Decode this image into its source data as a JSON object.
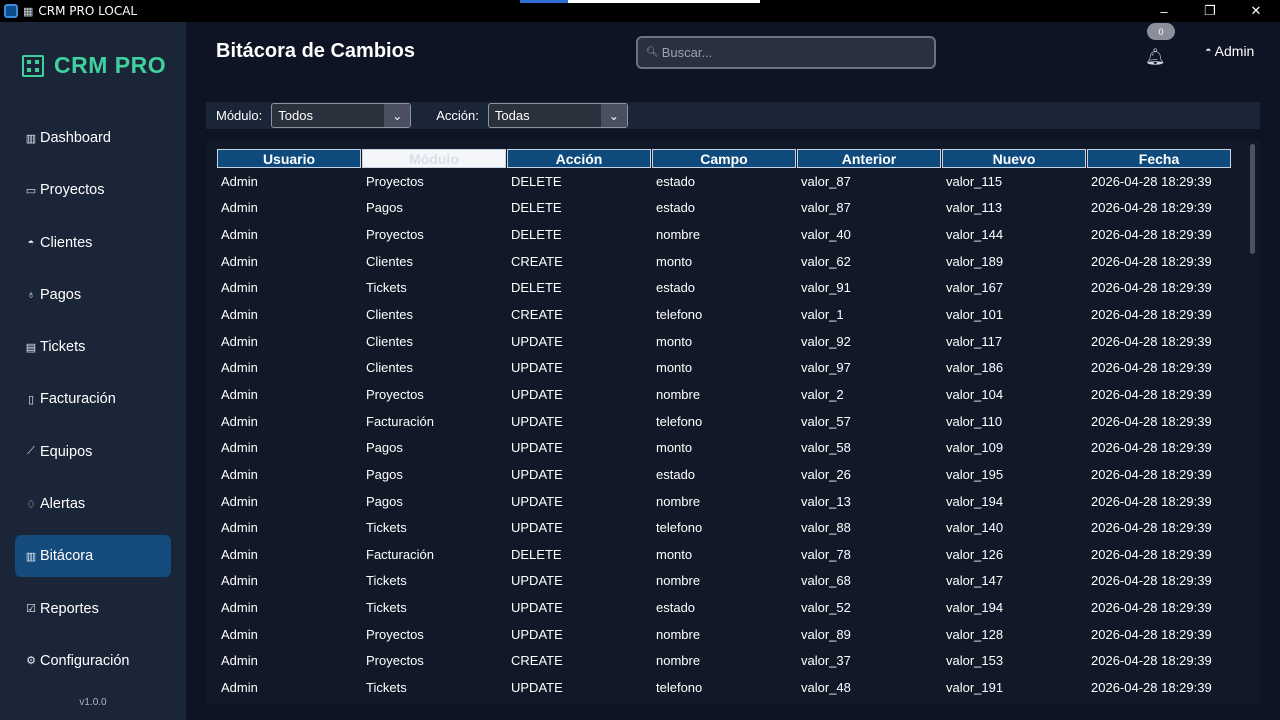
{
  "window": {
    "title": "CRM PRO LOCAL",
    "app_icon": "app-window-icon",
    "small_icon": "building-icon",
    "progress": 0.2,
    "colors": {
      "accent": "#2f6fd6"
    },
    "controls": {
      "minimize": "–",
      "maximize": "❐",
      "close": "✕"
    }
  },
  "brand": {
    "name": "CRM PRO",
    "icon": "building-icon",
    "color": "#3fd09e"
  },
  "sidebar": {
    "items": [
      {
        "label": "Dashboard",
        "icon": "bar-chart-icon",
        "glyph": "▥"
      },
      {
        "label": "Proyectos",
        "icon": "folder-icon",
        "glyph": "▭"
      },
      {
        "label": "Clientes",
        "icon": "user-icon",
        "glyph": "◓"
      },
      {
        "label": "Pagos",
        "icon": "money-bag-icon",
        "glyph": "♁"
      },
      {
        "label": "Tickets",
        "icon": "ticket-icon",
        "glyph": "▤"
      },
      {
        "label": "Facturación",
        "icon": "document-icon",
        "glyph": "▯"
      },
      {
        "label": "Equipos",
        "icon": "wrench-icon",
        "glyph": "⟋"
      },
      {
        "label": "Alertas",
        "icon": "bell-icon",
        "glyph": "♢"
      },
      {
        "label": "Bitácora",
        "icon": "bar-chart-icon",
        "glyph": "▥",
        "active": true
      },
      {
        "label": "Reportes",
        "icon": "check-square-icon",
        "glyph": "☑"
      },
      {
        "label": "Configuración",
        "icon": "gear-icon",
        "glyph": "⚙"
      }
    ],
    "version": "v1.0.0",
    "active_color": "#144a7c"
  },
  "header": {
    "title": "Bitácora de Cambios",
    "search": {
      "placeholder": "Buscar...",
      "value": "",
      "icon": "search-icon"
    },
    "notifications": {
      "count": "0",
      "icon": "bell-icon"
    },
    "user": {
      "label": "Admin",
      "icon": "user-icon"
    }
  },
  "filters": {
    "modulo": {
      "label": "Módulo:",
      "value": "Todos"
    },
    "accion": {
      "label": "Acción:",
      "value": "Todas"
    },
    "dropdown_glyph": "⌄"
  },
  "table": {
    "columns": [
      "Usuario",
      "Módulo",
      "Acción",
      "Campo",
      "Anterior",
      "Nuevo",
      "Fecha"
    ],
    "selected_column": 1,
    "rows": [
      [
        "Admin",
        "Proyectos",
        "DELETE",
        "estado",
        "valor_87",
        "valor_115",
        "2026-04-28 18:29:39"
      ],
      [
        "Admin",
        "Pagos",
        "DELETE",
        "estado",
        "valor_87",
        "valor_113",
        "2026-04-28 18:29:39"
      ],
      [
        "Admin",
        "Proyectos",
        "DELETE",
        "nombre",
        "valor_40",
        "valor_144",
        "2026-04-28 18:29:39"
      ],
      [
        "Admin",
        "Clientes",
        "CREATE",
        "monto",
        "valor_62",
        "valor_189",
        "2026-04-28 18:29:39"
      ],
      [
        "Admin",
        "Tickets",
        "DELETE",
        "estado",
        "valor_91",
        "valor_167",
        "2026-04-28 18:29:39"
      ],
      [
        "Admin",
        "Clientes",
        "CREATE",
        "telefono",
        "valor_1",
        "valor_101",
        "2026-04-28 18:29:39"
      ],
      [
        "Admin",
        "Clientes",
        "UPDATE",
        "monto",
        "valor_92",
        "valor_117",
        "2026-04-28 18:29:39"
      ],
      [
        "Admin",
        "Clientes",
        "UPDATE",
        "monto",
        "valor_97",
        "valor_186",
        "2026-04-28 18:29:39"
      ],
      [
        "Admin",
        "Proyectos",
        "UPDATE",
        "nombre",
        "valor_2",
        "valor_104",
        "2026-04-28 18:29:39"
      ],
      [
        "Admin",
        "Facturación",
        "UPDATE",
        "telefono",
        "valor_57",
        "valor_110",
        "2026-04-28 18:29:39"
      ],
      [
        "Admin",
        "Pagos",
        "UPDATE",
        "monto",
        "valor_58",
        "valor_109",
        "2026-04-28 18:29:39"
      ],
      [
        "Admin",
        "Pagos",
        "UPDATE",
        "estado",
        "valor_26",
        "valor_195",
        "2026-04-28 18:29:39"
      ],
      [
        "Admin",
        "Pagos",
        "UPDATE",
        "nombre",
        "valor_13",
        "valor_194",
        "2026-04-28 18:29:39"
      ],
      [
        "Admin",
        "Tickets",
        "UPDATE",
        "telefono",
        "valor_88",
        "valor_140",
        "2026-04-28 18:29:39"
      ],
      [
        "Admin",
        "Facturación",
        "DELETE",
        "monto",
        "valor_78",
        "valor_126",
        "2026-04-28 18:29:39"
      ],
      [
        "Admin",
        "Tickets",
        "UPDATE",
        "nombre",
        "valor_68",
        "valor_147",
        "2026-04-28 18:29:39"
      ],
      [
        "Admin",
        "Tickets",
        "UPDATE",
        "estado",
        "valor_52",
        "valor_194",
        "2026-04-28 18:29:39"
      ],
      [
        "Admin",
        "Proyectos",
        "UPDATE",
        "nombre",
        "valor_89",
        "valor_128",
        "2026-04-28 18:29:39"
      ],
      [
        "Admin",
        "Proyectos",
        "CREATE",
        "nombre",
        "valor_37",
        "valor_153",
        "2026-04-28 18:29:39"
      ],
      [
        "Admin",
        "Tickets",
        "UPDATE",
        "telefono",
        "valor_48",
        "valor_191",
        "2026-04-28 18:29:39"
      ]
    ],
    "header_color": "#0f4a7c"
  }
}
